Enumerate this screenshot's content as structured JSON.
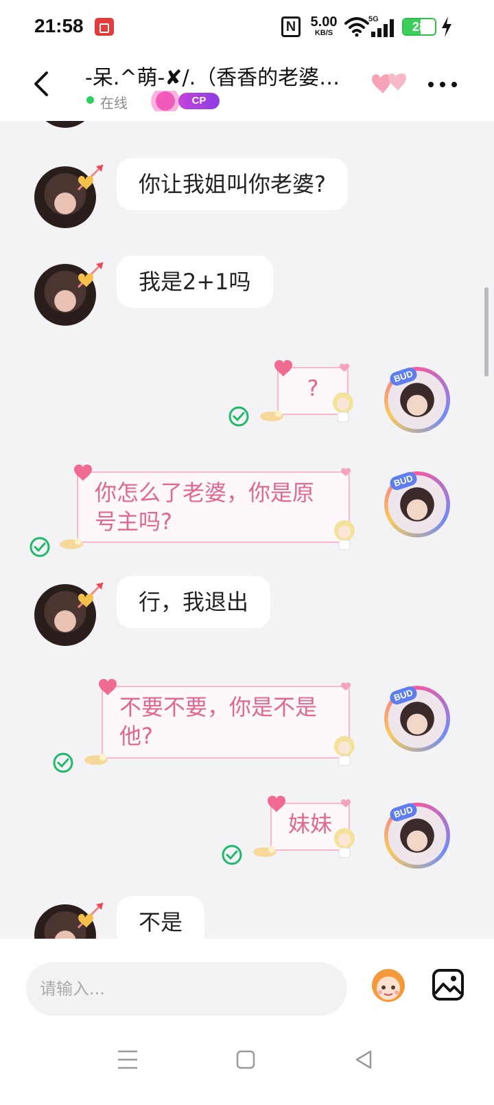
{
  "status_bar": {
    "time": "21:58",
    "network_speed_value": "5.00",
    "network_speed_unit": "KB/S",
    "signal_label": "5G",
    "battery_level": "28",
    "icons": [
      "screen-record-icon",
      "nfc-icon",
      "wifi-icon",
      "cellular-signal-icon",
      "battery-icon",
      "charging-bolt-icon"
    ]
  },
  "header": {
    "title": "-呆.^萌-✘/.（香香的老婆…",
    "online_status": "在线",
    "cp_badge": "CP",
    "icons": [
      "back-arrow-icon",
      "hearts-icon",
      "more-icon"
    ]
  },
  "messages": [
    {
      "side": "left",
      "text": "你让我姐叫你老婆?"
    },
    {
      "side": "left",
      "text": "我是2+1吗"
    },
    {
      "side": "right",
      "text": "?",
      "read": true
    },
    {
      "side": "right",
      "text_lines": [
        "你怎么了老婆，你是原",
        "号主吗?"
      ],
      "read": true
    },
    {
      "side": "left",
      "text": "行，我退出"
    },
    {
      "side": "right",
      "text_lines": [
        "不要不要，你是不是",
        "他?"
      ],
      "read": true
    },
    {
      "side": "right",
      "text": "妹妹",
      "read": true
    },
    {
      "side": "left",
      "text": "不是"
    }
  ],
  "input_bar": {
    "placeholder": "请输入...",
    "icons": [
      "sticker-icon",
      "image-icon"
    ]
  },
  "nav_bar": {
    "icons": [
      "menu-icon",
      "home-square-icon",
      "back-triangle-icon"
    ]
  },
  "colors": {
    "accent_pink": "#e0678f",
    "online_green": "#2bd05f",
    "read_check_green": "#1fb86a",
    "battery_green": "#3dcf5c",
    "cp_purple": "#8c3de6"
  }
}
